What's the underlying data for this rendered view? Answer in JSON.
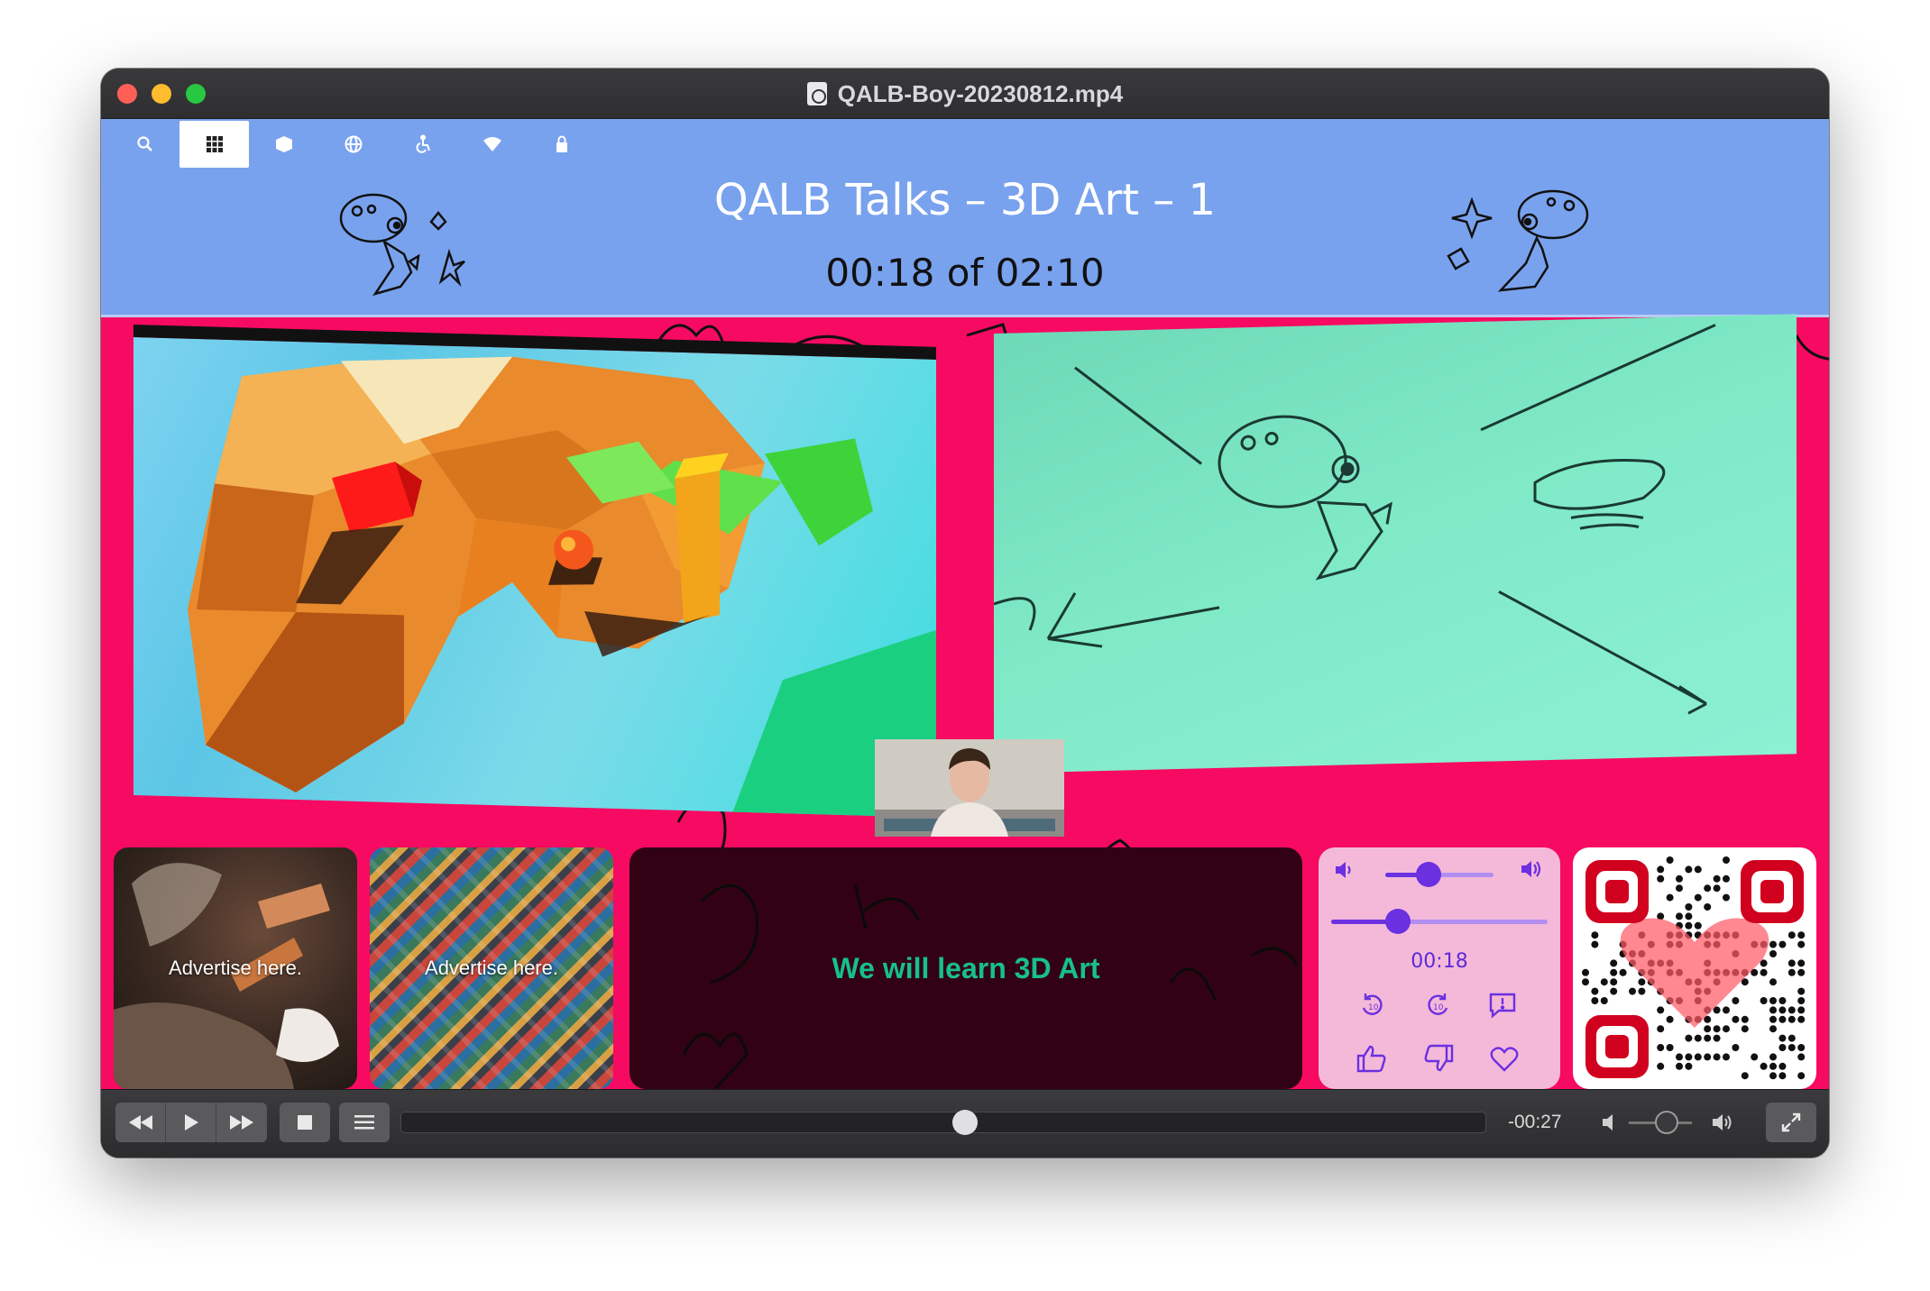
{
  "window": {
    "title": "QALB-Boy-20230812.mp4"
  },
  "toolbar": {
    "buttons": [
      {
        "icon": "search-icon",
        "glyph": "⌕"
      },
      {
        "icon": "grid-icon",
        "glyph": "▦"
      },
      {
        "icon": "box-icon",
        "glyph": "◆"
      },
      {
        "icon": "globe-icon",
        "glyph": "◍"
      },
      {
        "icon": "accessibility-icon",
        "glyph": "♿"
      },
      {
        "icon": "wifi-icon",
        "glyph": "▾"
      },
      {
        "icon": "lock-icon",
        "glyph": "▮"
      }
    ],
    "active_index": 1
  },
  "header": {
    "title": "QALB Talks – 3D Art – 1",
    "time": "00:18 of 02:10"
  },
  "ads": [
    {
      "label": "Advertise here."
    },
    {
      "label": "Advertise here."
    }
  ],
  "caption": {
    "text": "We will learn 3D Art"
  },
  "controls_card": {
    "volume_level": 0.4,
    "progress_level": 0.31,
    "time": "00:18",
    "icons": [
      "volume-down-icon",
      "volume-up-icon",
      "rewind-10-icon",
      "forward-10-icon",
      "report-icon",
      "thumbs-up-icon",
      "thumbs-down-icon",
      "heart-icon"
    ]
  },
  "player": {
    "buttons": [
      "rewind-icon",
      "play-icon",
      "fast-forward-icon",
      "stop-icon",
      "playlist-icon"
    ],
    "remaining": "-00:27",
    "seek_position": 0.52,
    "volume_level": 0.6
  },
  "colors": {
    "background_pink": "#f70a62",
    "header_blue": "#79a2ee",
    "accent_purple": "#6b30e0",
    "caption_green": "#17c08a"
  }
}
